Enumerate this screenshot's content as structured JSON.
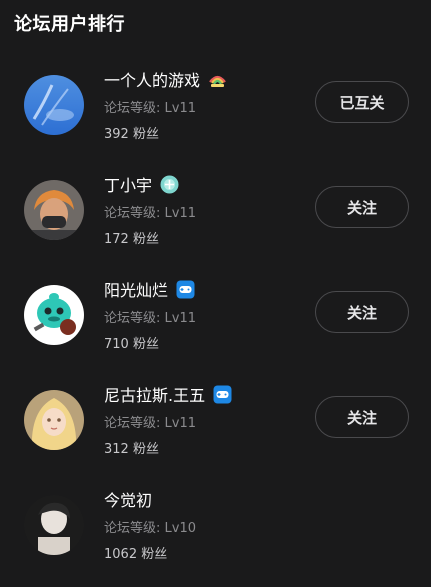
{
  "panel": {
    "title": "论坛用户排行"
  },
  "users": [
    {
      "name": "一个人的游戏",
      "level": "论坛等级: Lv11",
      "fans": "392 粉丝",
      "button": "已互关",
      "badge_icon": "rainbow-badge-icon",
      "avatar_icon": "sky-avatar-icon"
    },
    {
      "name": "丁小宇",
      "level": "论坛等级: Lv11",
      "fans": "172 粉丝",
      "button": "关注",
      "badge_icon": "teal-badge-icon",
      "avatar_icon": "person-avatar-icon"
    },
    {
      "name": "阳光灿烂",
      "level": "论坛等级: Lv11",
      "fans": "710 粉丝",
      "button": "关注",
      "badge_icon": "gamepad-badge-icon",
      "avatar_icon": "cartoon-avatar-icon"
    },
    {
      "name": "尼古拉斯.王五",
      "level": "论坛等级: Lv11",
      "fans": "312 粉丝",
      "button": "关注",
      "badge_icon": "gamepad-badge-icon",
      "avatar_icon": "anime-avatar-icon"
    },
    {
      "name": "今觉初",
      "level": "论坛等级: Lv10",
      "fans": "1062 粉丝",
      "button": "",
      "badge_icon": "",
      "avatar_icon": "portrait-avatar-icon"
    }
  ],
  "colors": {
    "background": "#1a1a1b",
    "text_primary": "#ffffff",
    "text_secondary": "#8b8b8e",
    "button_border": "#4a4a4d",
    "badge_blue": "#1e88e5",
    "badge_teal": "#7fd6cf"
  }
}
